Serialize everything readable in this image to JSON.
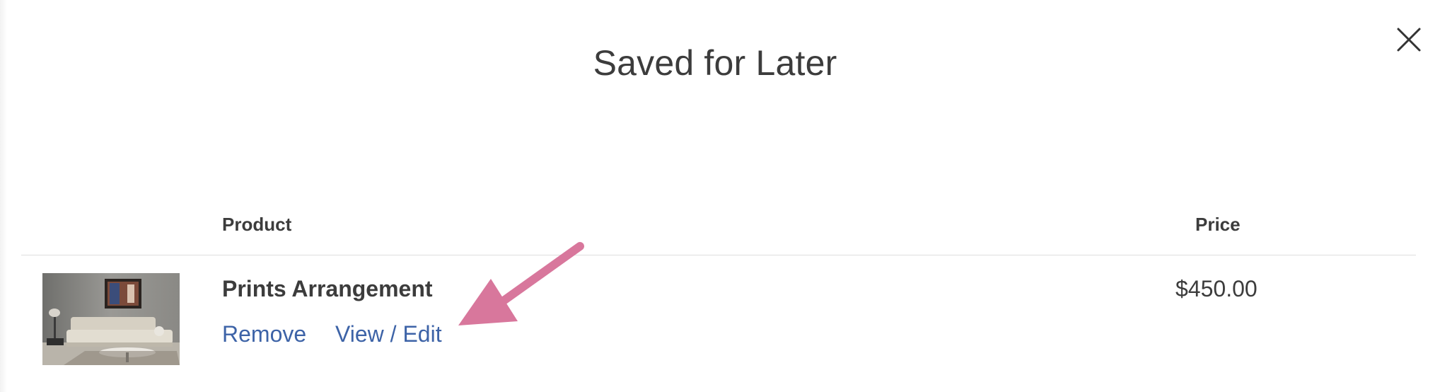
{
  "modal": {
    "title": "Saved for Later",
    "close_icon": "close-icon"
  },
  "table": {
    "headers": {
      "product": "Product",
      "price": "Price"
    },
    "rows": [
      {
        "image_icon": "product-thumbnail-living-room",
        "name": "Prints Arrangement",
        "price": "$450.00",
        "actions": {
          "remove": "Remove",
          "view_edit": "View / Edit"
        }
      }
    ]
  },
  "colors": {
    "link": "#3d63a7",
    "text": "#3c3c3c",
    "divider": "#dedede",
    "annotation_arrow": "#d8779c"
  },
  "annotation": {
    "arrow_icon": "pointer-arrow-icon"
  }
}
